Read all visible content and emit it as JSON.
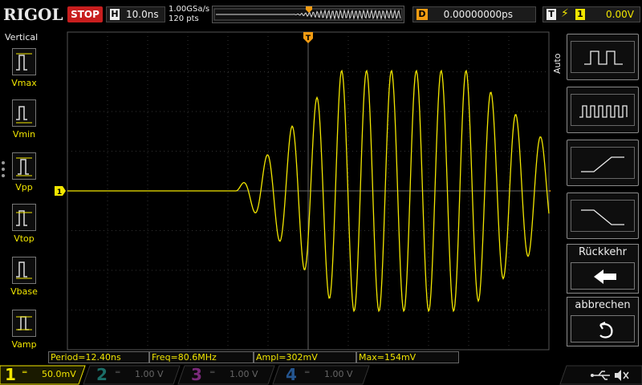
{
  "brand": "RIGOL",
  "run_state": "STOP",
  "horizontal": {
    "key": "H",
    "value": "10.0ns",
    "sample_rate": "1.00GSa/s",
    "points": "120 pts"
  },
  "delay": {
    "key": "D",
    "value": "0.00000000ps"
  },
  "trigger": {
    "key": "T",
    "edge_icon": "rising-edge-icon",
    "channel": "1",
    "level": "0.00V"
  },
  "left_menu": {
    "title": "Vertical",
    "items": [
      {
        "label": "Vmax"
      },
      {
        "label": "Vmin"
      },
      {
        "label": "Vpp"
      },
      {
        "label": "Vtop"
      },
      {
        "label": "Vbase"
      },
      {
        "label": "Vamp"
      }
    ]
  },
  "right_menu": {
    "title": "Auto",
    "buttons": [
      {
        "icon": "pulse-wide-icon"
      },
      {
        "icon": "pulse-train-icon"
      },
      {
        "icon": "rising-ramp-icon"
      },
      {
        "icon": "falling-ramp-icon"
      }
    ],
    "back_label": "Rückkehr",
    "cancel_label": "abbrechen"
  },
  "results": [
    "Period=12.40ns",
    "Freq=80.6MHz",
    "Ampl=302mV",
    "Max=154mV"
  ],
  "channels": [
    {
      "num": "1",
      "scale": "50.0mV",
      "color": "#f2e600",
      "active": true
    },
    {
      "num": "2",
      "scale": "1.00 V",
      "color": "#22b5a8",
      "active": false
    },
    {
      "num": "3",
      "scale": "1.00 V",
      "color": "#d23bd2",
      "active": false
    },
    {
      "num": "4",
      "scale": "1.00 V",
      "color": "#2e7bd8",
      "active": false
    }
  ],
  "markers": {
    "ch1_ground": "1",
    "trigger_pos": "T"
  },
  "colors": {
    "ch1": "#f2e600",
    "trigger": "#f39c12",
    "stop": "#c81e1e"
  }
}
